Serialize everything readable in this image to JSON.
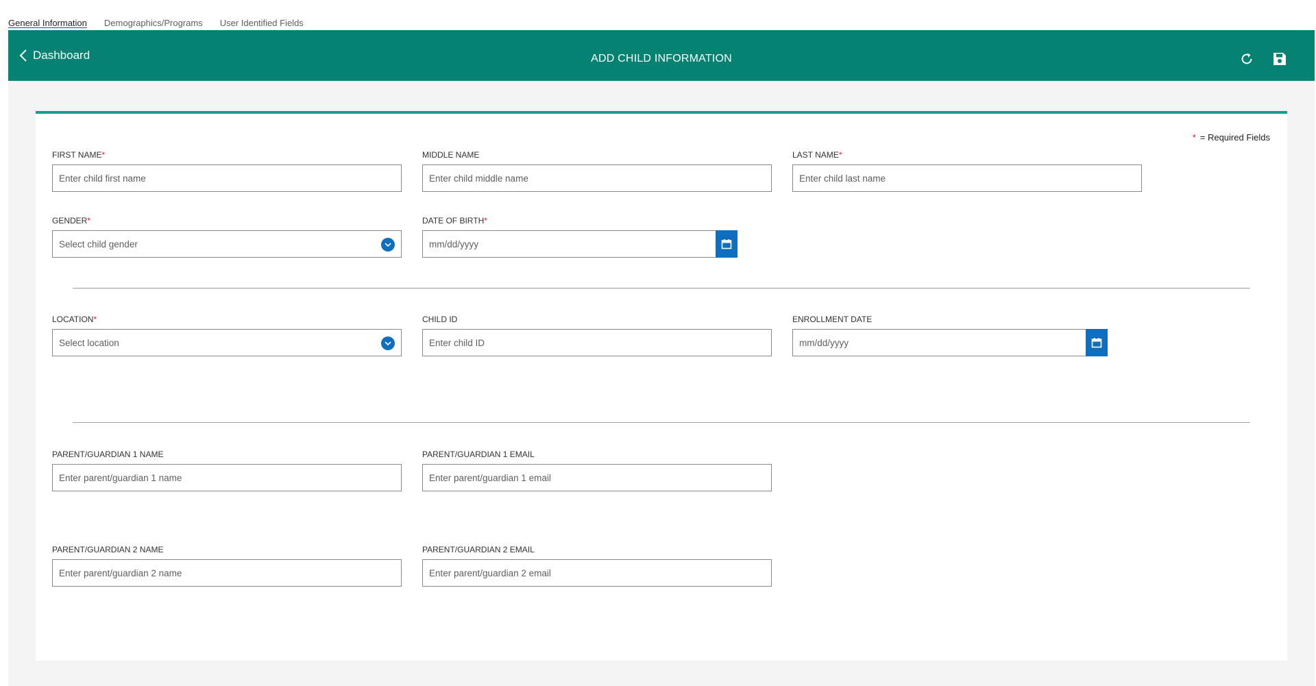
{
  "tabs": [
    {
      "label": "General Information",
      "active": true
    },
    {
      "label": "Demographics/Programs",
      "active": false
    },
    {
      "label": "User Identified Fields",
      "active": false
    }
  ],
  "header": {
    "back_label": "Dashboard",
    "title": "ADD CHILD INFORMATION",
    "icons": [
      "back-chevron-icon",
      "refresh-icon",
      "save-icon"
    ],
    "color": "#058272"
  },
  "required_note": {
    "star": "*",
    "text": "=  Required Fields"
  },
  "fields": {
    "first_name": {
      "label": "FIRST NAME",
      "required": "*",
      "placeholder": "Enter child first name"
    },
    "middle_name": {
      "label": "MIDDLE NAME",
      "placeholder": "Enter child middle name"
    },
    "last_name": {
      "label": "LAST NAME",
      "required": "*",
      "placeholder": "Enter child last name"
    },
    "gender": {
      "label": "GENDER",
      "required": "*",
      "placeholder": "Select child gender"
    },
    "dob": {
      "label": "DATE OF BIRTH",
      "required": "*",
      "placeholder": "mm/dd/yyyy"
    },
    "location": {
      "label": "LOCATION",
      "required": "*",
      "placeholder": "Select location"
    },
    "child_id": {
      "label": "CHILD ID",
      "placeholder": "Enter child ID"
    },
    "enrollment_date": {
      "label": "ENROLLMENT DATE",
      "placeholder": "mm/dd/yyyy"
    },
    "parent1_name": {
      "label": "PARENT/GUARDIAN 1 NAME",
      "placeholder": "Enter parent/guardian 1 name"
    },
    "parent1_email": {
      "label": "PARENT/GUARDIAN 1 EMAIL",
      "placeholder": "Enter parent/guardian 1 email"
    },
    "parent2_name": {
      "label": "PARENT/GUARDIAN 2 NAME",
      "placeholder": "Enter parent/guardian 2 name"
    },
    "parent2_email": {
      "label": "PARENT/GUARDIAN 2 EMAIL",
      "placeholder": "Enter parent/guardian 2 email"
    }
  },
  "colors": {
    "accent": "#106ebe",
    "required": "#e81123",
    "card_border": "#0fa08e"
  }
}
